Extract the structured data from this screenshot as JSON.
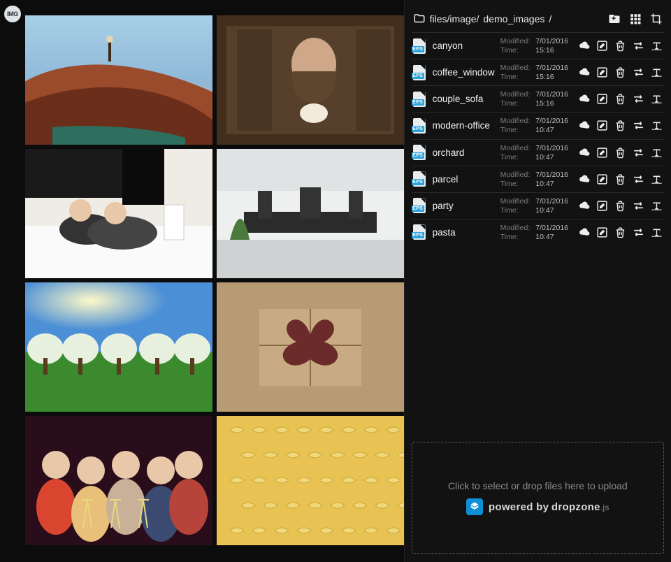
{
  "logo_text": "IMG",
  "breadcrumb": {
    "root": "files/image/",
    "current": "demo_images",
    "suffix": "/"
  },
  "top_actions": [
    {
      "name": "new-folder-icon"
    },
    {
      "name": "grid-view-icon"
    },
    {
      "name": "crop-icon"
    }
  ],
  "meta_labels": {
    "modified": "Modified:",
    "time": "Time:"
  },
  "file_icon_tag": "EPS",
  "files": [
    {
      "name": "canyon",
      "modified": "7/01/2016",
      "time": "15:16"
    },
    {
      "name": "coffee_window",
      "modified": "7/01/2016",
      "time": "15:16"
    },
    {
      "name": "couple_sofa",
      "modified": "7/01/2016",
      "time": "15:16"
    },
    {
      "name": "modern-office",
      "modified": "7/01/2016",
      "time": "10:47"
    },
    {
      "name": "orchard",
      "modified": "7/01/2016",
      "time": "10:47"
    },
    {
      "name": "parcel",
      "modified": "7/01/2016",
      "time": "10:47"
    },
    {
      "name": "party",
      "modified": "7/01/2016",
      "time": "10:47"
    },
    {
      "name": "pasta",
      "modified": "7/01/2016",
      "time": "10:47"
    }
  ],
  "row_action_names": [
    "download-icon",
    "edit-icon",
    "delete-icon",
    "move-icon",
    "text-icon"
  ],
  "thumbnails": [
    "canyon",
    "coffee_window",
    "couple_sofa",
    "modern-office",
    "orchard",
    "parcel",
    "party",
    "pasta"
  ],
  "dropzone": {
    "text": "Click to select or drop files here to upload",
    "powered_by": "powered by",
    "brand": "dropzone",
    "suffix": ".js"
  }
}
